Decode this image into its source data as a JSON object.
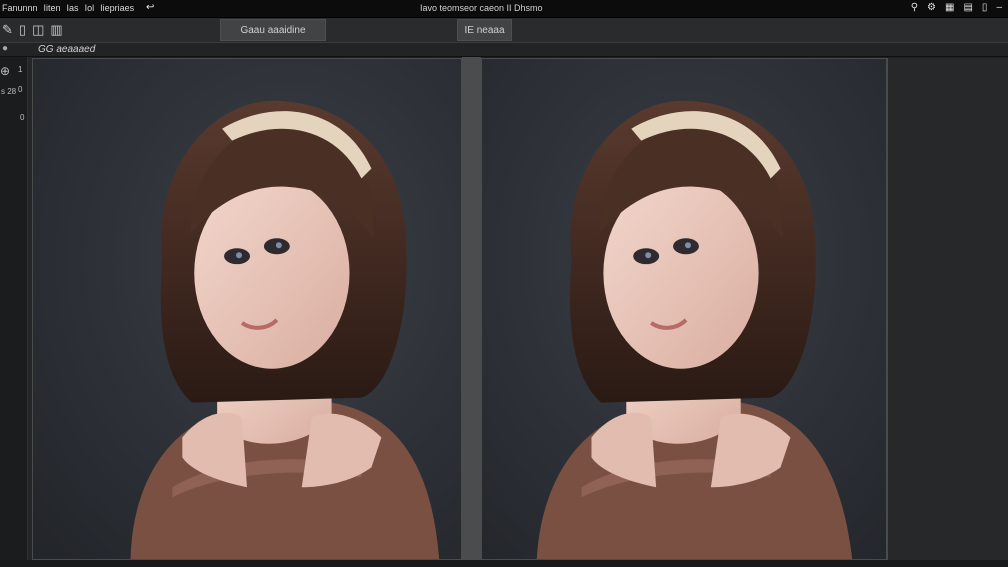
{
  "menubar": {
    "menus": [
      "Fanunnn",
      "Iiten",
      "Ias",
      "Iol",
      "Iiepriaes"
    ],
    "back_icon": "back-arrow-icon",
    "title": "Iavo teomseor caeon II Dhsmo",
    "controls": [
      "search-icon",
      "settings-icon",
      "grid-icon",
      "grid-alt-icon",
      "file-icon",
      "minimize-icon"
    ]
  },
  "toolbar": {
    "icons": [
      "pen-icon",
      "document-icon",
      "columns-icon",
      "stack-icon"
    ],
    "tab_left": "Gaau aaaidine",
    "tab_right": "IE neaaa"
  },
  "subbar": {
    "label": "GG aeaaaed"
  },
  "lefttools": {
    "items": [
      "1",
      "0",
      "s 28",
      "0"
    ]
  },
  "images": {
    "left": "portrait-original",
    "right": "portrait-processed"
  },
  "colors": {
    "background": "#1e1f21",
    "panel": "#2b2e33",
    "divider": "#4b4c4e"
  }
}
